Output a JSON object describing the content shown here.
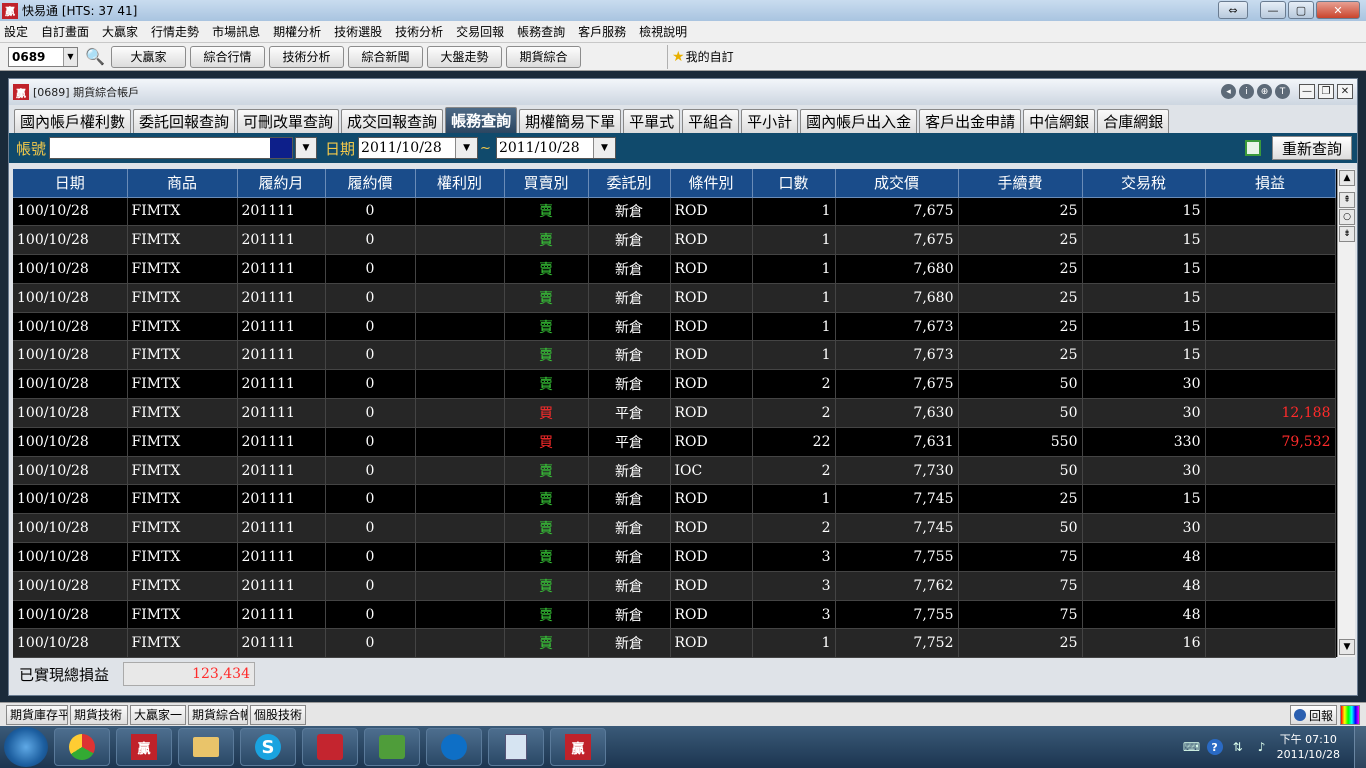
{
  "window": {
    "title": "快易通  [HTS: 37 41]"
  },
  "menu": [
    "設定",
    "自訂畫面",
    "大贏家",
    "行情走勢",
    "市場訊息",
    "期權分析",
    "技術選股",
    "技術分析",
    "交易回報",
    "帳務查詢",
    "客戶服務",
    "檢視說明"
  ],
  "toolbar": {
    "stock_code": "0689",
    "buttons": [
      "大贏家",
      "綜合行情",
      "技術分析",
      "綜合新聞",
      "大盤走勢",
      "期貨綜合"
    ],
    "favorites": "我的自訂"
  },
  "inner_window": {
    "title": "[0689] 期貨綜合帳戶"
  },
  "tabs": [
    "國內帳戶權利數",
    "委託回報查詢",
    "可刪改單查詢",
    "成交回報查詢",
    "帳務查詢",
    "期權簡易下單",
    "平單式",
    "平組合",
    "平小計",
    "國內帳戶出入金",
    "客戶出金申請",
    "中信網銀",
    "合庫網銀"
  ],
  "active_tab": "帳務查詢",
  "filter": {
    "account_label": "帳號",
    "account_value": "",
    "date_label": "日期",
    "date_from": "2011/10/28",
    "tilde": "~",
    "date_to": "2011/10/28",
    "refresh_label": "重新查詢"
  },
  "table": {
    "columns": [
      "日期",
      "商品",
      "履約月",
      "履約價",
      "權利別",
      "買賣別",
      "委託別",
      "條件別",
      "口數",
      "成交價",
      "手續費",
      "交易稅",
      "損益"
    ],
    "rows": [
      [
        "100/10/28",
        "FIMTX",
        "201111",
        "0",
        "",
        "賣",
        "新倉",
        "ROD",
        "1",
        "7,675",
        "25",
        "15",
        ""
      ],
      [
        "100/10/28",
        "FIMTX",
        "201111",
        "0",
        "",
        "賣",
        "新倉",
        "ROD",
        "1",
        "7,675",
        "25",
        "15",
        ""
      ],
      [
        "100/10/28",
        "FIMTX",
        "201111",
        "0",
        "",
        "賣",
        "新倉",
        "ROD",
        "1",
        "7,680",
        "25",
        "15",
        ""
      ],
      [
        "100/10/28",
        "FIMTX",
        "201111",
        "0",
        "",
        "賣",
        "新倉",
        "ROD",
        "1",
        "7,680",
        "25",
        "15",
        ""
      ],
      [
        "100/10/28",
        "FIMTX",
        "201111",
        "0",
        "",
        "賣",
        "新倉",
        "ROD",
        "1",
        "7,673",
        "25",
        "15",
        ""
      ],
      [
        "100/10/28",
        "FIMTX",
        "201111",
        "0",
        "",
        "賣",
        "新倉",
        "ROD",
        "1",
        "7,673",
        "25",
        "15",
        ""
      ],
      [
        "100/10/28",
        "FIMTX",
        "201111",
        "0",
        "",
        "賣",
        "新倉",
        "ROD",
        "2",
        "7,675",
        "50",
        "30",
        ""
      ],
      [
        "100/10/28",
        "FIMTX",
        "201111",
        "0",
        "",
        "買",
        "平倉",
        "ROD",
        "2",
        "7,630",
        "50",
        "30",
        "12,188"
      ],
      [
        "100/10/28",
        "FIMTX",
        "201111",
        "0",
        "",
        "買",
        "平倉",
        "ROD",
        "22",
        "7,631",
        "550",
        "330",
        "79,532"
      ],
      [
        "100/10/28",
        "FIMTX",
        "201111",
        "0",
        "",
        "賣",
        "新倉",
        "IOC",
        "2",
        "7,730",
        "50",
        "30",
        ""
      ],
      [
        "100/10/28",
        "FIMTX",
        "201111",
        "0",
        "",
        "賣",
        "新倉",
        "ROD",
        "1",
        "7,745",
        "25",
        "15",
        ""
      ],
      [
        "100/10/28",
        "FIMTX",
        "201111",
        "0",
        "",
        "賣",
        "新倉",
        "ROD",
        "2",
        "7,745",
        "50",
        "30",
        ""
      ],
      [
        "100/10/28",
        "FIMTX",
        "201111",
        "0",
        "",
        "賣",
        "新倉",
        "ROD",
        "3",
        "7,755",
        "75",
        "48",
        ""
      ],
      [
        "100/10/28",
        "FIMTX",
        "201111",
        "0",
        "",
        "賣",
        "新倉",
        "ROD",
        "3",
        "7,762",
        "75",
        "48",
        ""
      ],
      [
        "100/10/28",
        "FIMTX",
        "201111",
        "0",
        "",
        "賣",
        "新倉",
        "ROD",
        "3",
        "7,755",
        "75",
        "48",
        ""
      ],
      [
        "100/10/28",
        "FIMTX",
        "201111",
        "0",
        "",
        "賣",
        "新倉",
        "ROD",
        "1",
        "7,752",
        "25",
        "16",
        ""
      ]
    ]
  },
  "total": {
    "label": "已實現總損益",
    "value": "123,434"
  },
  "bottom_tabs": [
    "期貨庫存平",
    "期貨技術",
    "大贏家一",
    "期貨綜合帳",
    "個股技術"
  ],
  "bottom_right": {
    "back_label": "回報"
  },
  "clock": {
    "time": "下午 07:10",
    "date": "2011/10/28"
  },
  "colors": {
    "sell": "#3ad13a",
    "buy": "#ff2b2b",
    "header_bg": "#1a4c8a",
    "filter_bg": "#104a6c",
    "label_gold": "#f3c94a"
  }
}
